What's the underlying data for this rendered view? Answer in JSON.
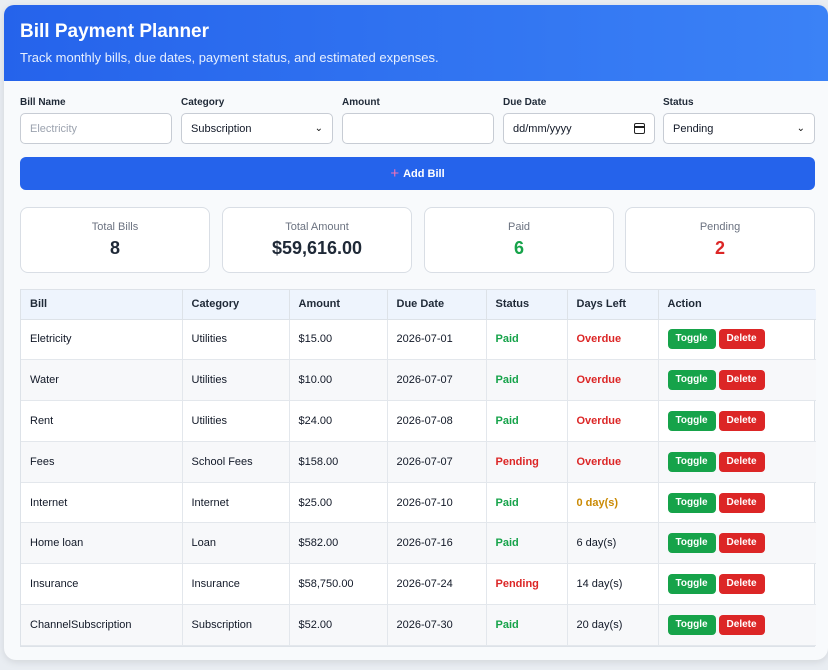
{
  "header": {
    "title": "Bill Payment Planner",
    "subtitle": "Track monthly bills, due dates, payment status, and estimated expenses."
  },
  "form": {
    "bill_name": {
      "label": "Bill Name",
      "placeholder": "Electricity",
      "value": ""
    },
    "category": {
      "label": "Category",
      "value": "Subscription"
    },
    "amount": {
      "label": "Amount",
      "value": ""
    },
    "due_date": {
      "label": "Due Date",
      "value": "dd/mm/yyyy"
    },
    "status": {
      "label": "Status",
      "value": "Pending"
    },
    "add_label": "Add Bill"
  },
  "stats": [
    {
      "label": "Total Bills",
      "value": "8",
      "color": "#1f2937"
    },
    {
      "label": "Total Amount",
      "value": "$59,616.00",
      "color": "#1f2937"
    },
    {
      "label": "Paid",
      "value": "6",
      "color": "#16a34a"
    },
    {
      "label": "Pending",
      "value": "2",
      "color": "#dc2626"
    }
  ],
  "table": {
    "headers": [
      "Bill",
      "Category",
      "Amount",
      "Due Date",
      "Status",
      "Days Left",
      "Action"
    ],
    "toggle_label": "Toggle",
    "delete_label": "Delete",
    "rows": [
      {
        "bill": "Eletricity",
        "category": "Utilities",
        "amount": "$15.00",
        "due": "2026-07-01",
        "status": "Paid",
        "days": "Overdue",
        "days_kind": "overdue"
      },
      {
        "bill": "Water",
        "category": "Utilities",
        "amount": "$10.00",
        "due": "2026-07-07",
        "status": "Paid",
        "days": "Overdue",
        "days_kind": "overdue"
      },
      {
        "bill": "Rent",
        "category": "Utilities",
        "amount": "$24.00",
        "due": "2026-07-08",
        "status": "Paid",
        "days": "Overdue",
        "days_kind": "overdue"
      },
      {
        "bill": "Fees",
        "category": "School Fees",
        "amount": "$158.00",
        "due": "2026-07-07",
        "status": "Pending",
        "days": "Overdue",
        "days_kind": "overdue"
      },
      {
        "bill": "Internet",
        "category": "Internet",
        "amount": "$25.00",
        "due": "2026-07-10",
        "status": "Paid",
        "days": "0 day(s)",
        "days_kind": "today"
      },
      {
        "bill": "Home loan",
        "category": "Loan",
        "amount": "$582.00",
        "due": "2026-07-16",
        "status": "Paid",
        "days": "6 day(s)",
        "days_kind": "normal"
      },
      {
        "bill": "Insurance",
        "category": "Insurance",
        "amount": "$58,750.00",
        "due": "2026-07-24",
        "status": "Pending",
        "days": "14 day(s)",
        "days_kind": "normal"
      },
      {
        "bill": "ChannelSubscription",
        "category": "Subscription",
        "amount": "$52.00",
        "due": "2026-07-30",
        "status": "Paid",
        "days": "20 day(s)",
        "days_kind": "normal"
      }
    ]
  }
}
